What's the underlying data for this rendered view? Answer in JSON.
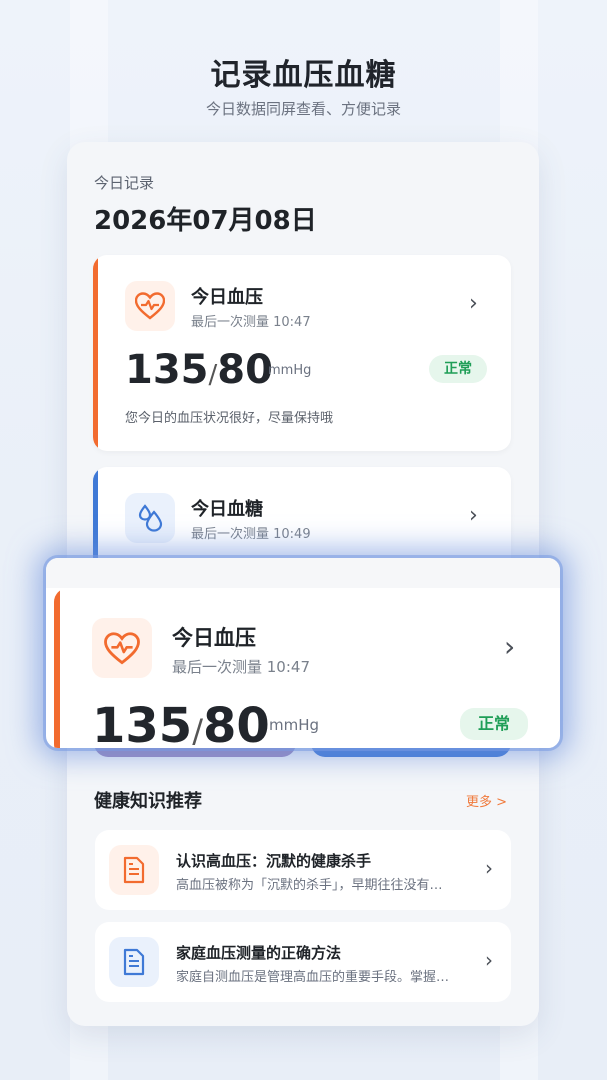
{
  "promo": {
    "title": "记录血压血糖",
    "subtitle": "今日数据同屏查看、方便记录"
  },
  "today": {
    "label": "今日记录",
    "date": "2026年07月08日"
  },
  "bp_card": {
    "title": "今日血压",
    "subtitle": "最后一次测量 10:47",
    "systolic": "135",
    "slash": "/",
    "diastolic": "80",
    "unit": "mmHg",
    "status": "正常",
    "description": "您今日的血压状况很好，尽量保持哦",
    "icon": "heart-pulse-icon",
    "accent": "#f26b2f",
    "icon_bg": "#fff1ea"
  },
  "glucose_card": {
    "title": "今日血糖",
    "subtitle": "最后一次测量 10:49",
    "icon": "water-drops-icon",
    "accent": "#3f79d6",
    "icon_bg": "#eaf1fc"
  },
  "health": {
    "title": "健康知识推荐",
    "more": "更多 >",
    "articles": [
      {
        "title": "认识高血压：沉默的健康杀手",
        "desc": "高血压被称为「沉默的杀手」，早期往往没有…",
        "icon": "document-icon",
        "color": "#f26b2f",
        "bg": "#fff1ea"
      },
      {
        "title": "家庭血压测量的正确方法",
        "desc": "家庭自测血压是管理高血压的重要手段。掌握…",
        "icon": "document-icon",
        "color": "#3f79d6",
        "bg": "#eaf1fc"
      }
    ]
  },
  "chevron": "›"
}
